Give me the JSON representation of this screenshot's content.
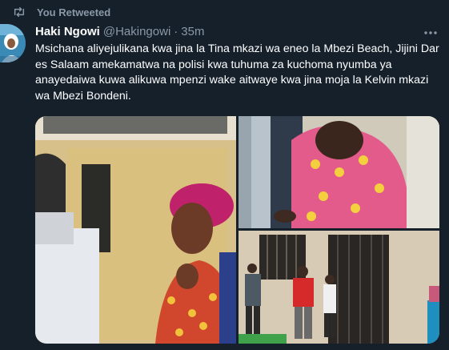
{
  "retweet": {
    "icon": "retweet-icon",
    "label": "You Retweeted"
  },
  "tweet": {
    "author_name": "Haki Ngowi",
    "author_handle": "@Hakingowi",
    "separator": "·",
    "time": "35m",
    "text": "Msichana aliyejulikana kwa jina la Tina mkazi wa eneo la Mbezi Beach, Jijini Dar  es Salaam amekamatwa na polisi kwa tuhuma za kuchoma nyumba ya anayedaiwa kuwa alikuwa mpenzi wake aitwaye kwa jina moja la Kelvin mkazi wa Mbezi Bondeni.",
    "more_icon": "more-icon"
  },
  "media": {
    "photos": [
      "photo-woman-headscarf",
      "photo-woman-seated",
      "photo-men-outside-house"
    ]
  },
  "colors": {
    "background": "#15202b",
    "secondary_text": "#8b98a5",
    "primary_text": "#ffffff"
  }
}
